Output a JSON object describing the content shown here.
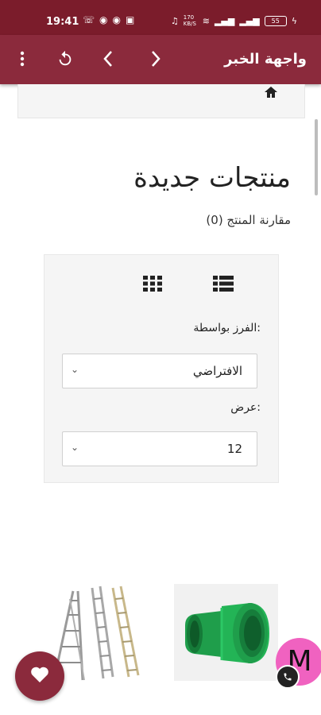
{
  "status_bar": {
    "time": "19:41",
    "network_speed": "170 KB/S",
    "battery": "55",
    "left_icons": [
      "phone-icon",
      "whatsapp-icon",
      "whatsapp-icon",
      "image-icon"
    ],
    "right_icons": [
      "headphones-icon",
      "wifi-icon",
      "signal-icon",
      "signal-icon",
      "battery-icon",
      "charging-icon"
    ]
  },
  "appbar": {
    "title": "واجهة الخبر",
    "icons": [
      "more-icon",
      "refresh-icon",
      "back-icon",
      "forward-icon"
    ]
  },
  "breadcrumb": {
    "home_icon": "home-icon"
  },
  "page": {
    "title": "منتجات جديدة",
    "compare_link": "مقارنة المنتج (0)"
  },
  "toolbar": {
    "list_view_icon": "list-view-icon",
    "grid_view_icon": "grid-view-icon",
    "sort_label": "الفرز بواسطة:",
    "sort_value": "الافتراضي",
    "show_label": "عرض:",
    "show_value": "12"
  },
  "products": [
    {
      "image": "green-pipe-fitting"
    },
    {
      "image": "aluminum-ladders"
    }
  ],
  "floating": {
    "favorite_icon": "heart-icon",
    "chat_avatar_letter": "M",
    "chat_badge_icon": "phone-icon"
  },
  "colors": {
    "status_bar": "#7b1c2b",
    "appbar": "#8b2a3c",
    "fab": "#8b2a3c",
    "chat_bubble": "#f062c0"
  }
}
